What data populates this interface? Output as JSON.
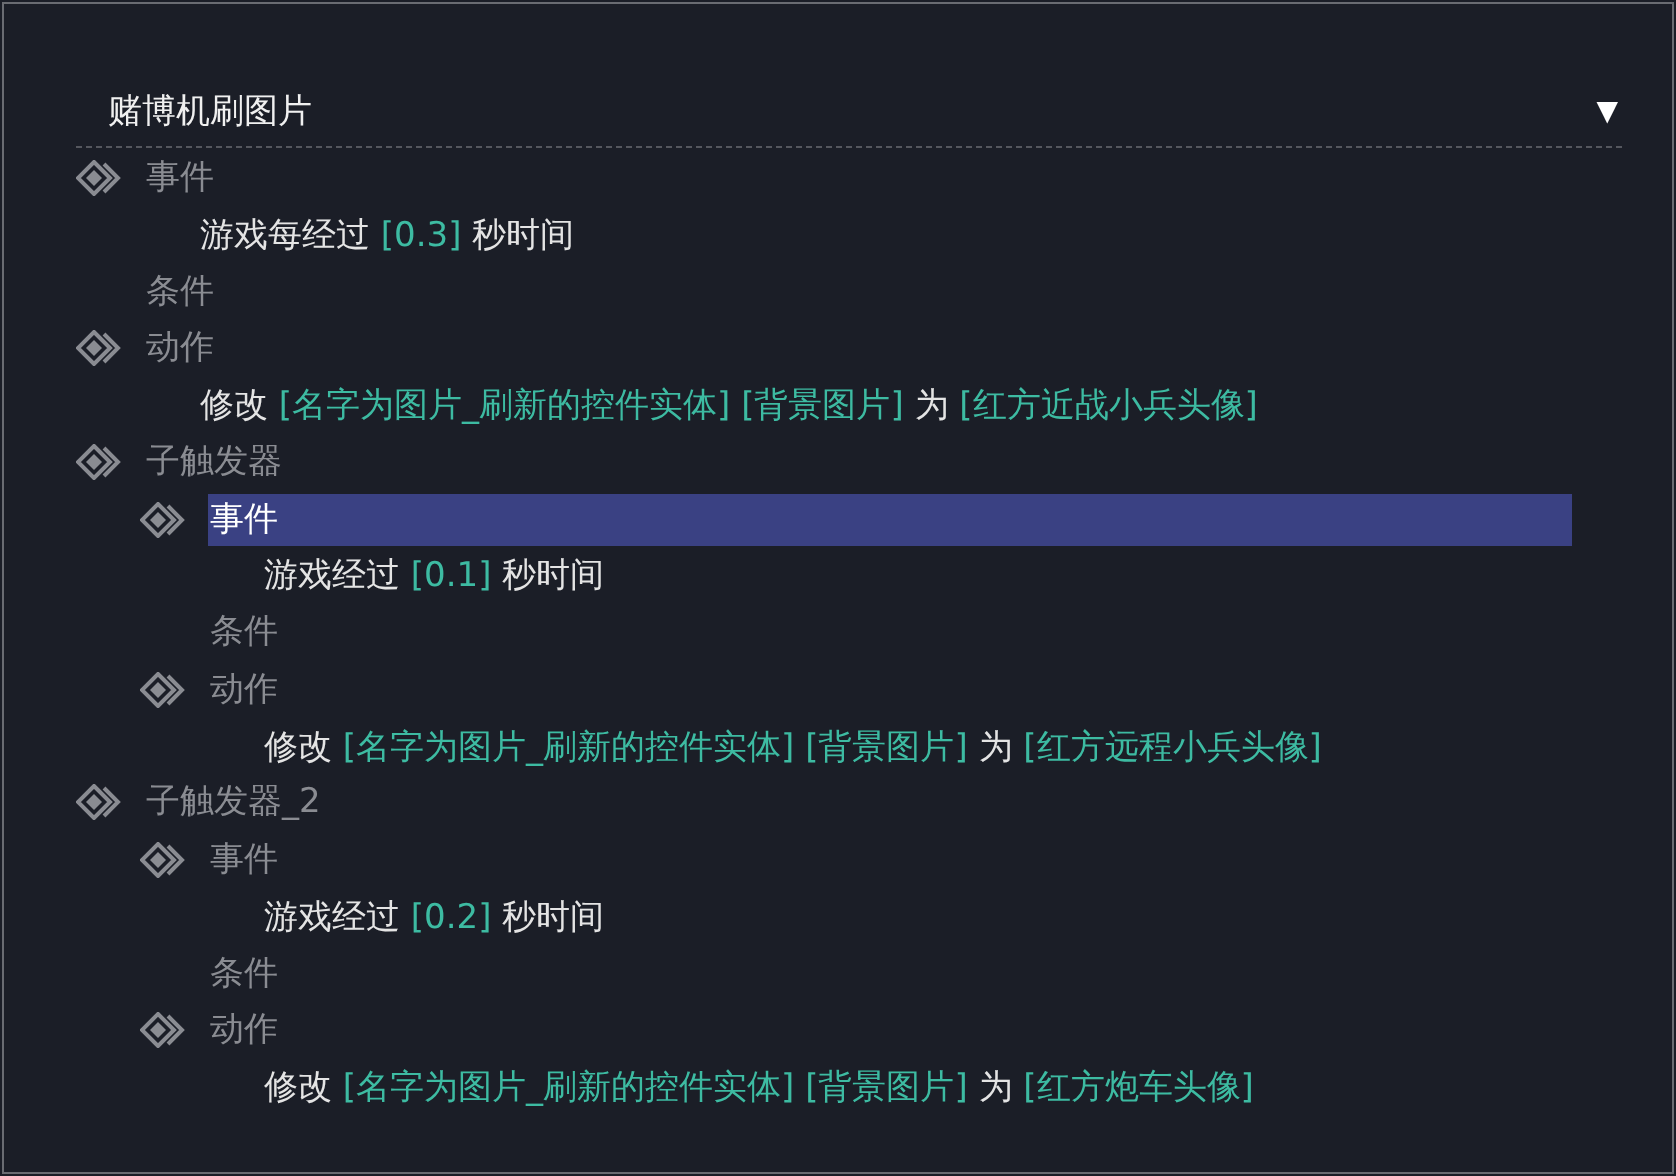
{
  "panel": {
    "title": "赌博机刷图片",
    "toggle": "▼"
  },
  "tree": [
    {
      "kind": "section",
      "label": "事件",
      "selected": false,
      "children": [
        {
          "kind": "statement",
          "selected": false,
          "parts": [
            {
              "kind": "plain",
              "text": "游戏每经过"
            },
            {
              "kind": "param",
              "text": "[0.3]"
            },
            {
              "kind": "plain",
              "text": "秒时间"
            }
          ]
        }
      ]
    },
    {
      "kind": "empty",
      "label": "条件",
      "selected": false
    },
    {
      "kind": "section",
      "label": "动作",
      "selected": false,
      "children": [
        {
          "kind": "statement",
          "selected": false,
          "parts": [
            {
              "kind": "plain",
              "text": "修改"
            },
            {
              "kind": "param",
              "text": "[名字为图片_刷新的控件实体]"
            },
            {
              "kind": "param",
              "text": "[背景图片]"
            },
            {
              "kind": "plain",
              "text": "为"
            },
            {
              "kind": "param",
              "text": "[红方近战小兵头像]"
            }
          ]
        }
      ]
    },
    {
      "kind": "section",
      "label": "子触发器",
      "selected": false,
      "children": [
        {
          "kind": "section",
          "label": "事件",
          "selected": true,
          "children": [
            {
              "kind": "statement",
              "selected": false,
              "parts": [
                {
                  "kind": "plain",
                  "text": "游戏经过"
                },
                {
                  "kind": "param",
                  "text": "[0.1]"
                },
                {
                  "kind": "plain",
                  "text": "秒时间"
                }
              ]
            }
          ]
        },
        {
          "kind": "empty",
          "label": "条件",
          "selected": false
        },
        {
          "kind": "section",
          "label": "动作",
          "selected": false,
          "children": [
            {
              "kind": "statement",
              "selected": false,
              "parts": [
                {
                  "kind": "plain",
                  "text": "修改"
                },
                {
                  "kind": "param",
                  "text": "[名字为图片_刷新的控件实体]"
                },
                {
                  "kind": "param",
                  "text": "[背景图片]"
                },
                {
                  "kind": "plain",
                  "text": "为"
                },
                {
                  "kind": "param",
                  "text": "[红方远程小兵头像]"
                }
              ]
            }
          ]
        }
      ]
    },
    {
      "kind": "section",
      "label": "子触发器_2",
      "selected": false,
      "children": [
        {
          "kind": "section",
          "label": "事件",
          "selected": false,
          "children": [
            {
              "kind": "statement",
              "selected": false,
              "parts": [
                {
                  "kind": "plain",
                  "text": "游戏经过"
                },
                {
                  "kind": "param",
                  "text": "[0.2]"
                },
                {
                  "kind": "plain",
                  "text": "秒时间"
                }
              ]
            }
          ]
        },
        {
          "kind": "empty",
          "label": "条件",
          "selected": false
        },
        {
          "kind": "section",
          "label": "动作",
          "selected": false,
          "children": [
            {
              "kind": "statement",
              "selected": false,
              "parts": [
                {
                  "kind": "plain",
                  "text": "修改"
                },
                {
                  "kind": "param",
                  "text": "[名字为图片_刷新的控件实体]"
                },
                {
                  "kind": "param",
                  "text": "[背景图片]"
                },
                {
                  "kind": "plain",
                  "text": "为"
                },
                {
                  "kind": "param",
                  "text": "[红方炮车头像]"
                }
              ]
            }
          ]
        }
      ]
    }
  ]
}
